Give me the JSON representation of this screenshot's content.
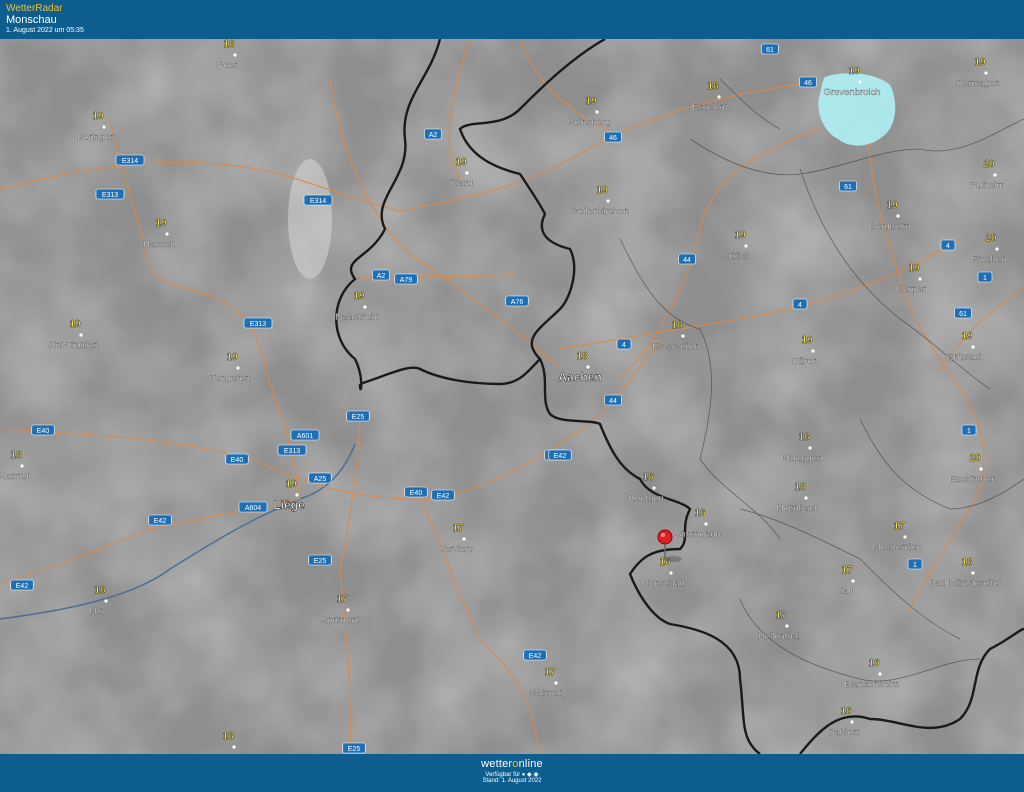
{
  "header": {
    "app_title": "WetterRadar",
    "location": "Monschau",
    "timestamp": "1. August 2022 um 05:35"
  },
  "footer": {
    "brand_a": "wetter",
    "brand_o": "o",
    "brand_b": "nline",
    "available": "Verfügbar für ● ◆ ◉",
    "stand": "Stand: 1. August 2022"
  },
  "colors": {
    "header_bg": "#0d5d8f",
    "accent": "#f2c230",
    "road": "#d98a4a",
    "border": "#1a1a1a",
    "river": "#4a6f96",
    "precip": "#aef1f5",
    "pin": "#e02020"
  },
  "pin": {
    "icon": "location-pin-icon",
    "city": "Monschau"
  },
  "cities": [
    {
      "name": "Peer",
      "temp": "18"
    },
    {
      "name": "Beringen",
      "temp": "19"
    },
    {
      "name": "Heinsberg",
      "temp": "19"
    },
    {
      "name": "Erkelenz",
      "temp": "18"
    },
    {
      "name": "Grevenbroich",
      "temp": "19"
    },
    {
      "name": "Dormagen",
      "temp": "19"
    },
    {
      "name": "Sittard",
      "temp": "19"
    },
    {
      "name": "Geilenkirchen",
      "temp": "19"
    },
    {
      "name": "Pulheim",
      "temp": "20"
    },
    {
      "name": "Hasselt",
      "temp": "19"
    },
    {
      "name": "Bergheim",
      "temp": "19"
    },
    {
      "name": "Jülich",
      "temp": "19"
    },
    {
      "name": "Frechen",
      "temp": "20"
    },
    {
      "name": "Kerpen",
      "temp": "19"
    },
    {
      "name": "Maastricht",
      "temp": "19"
    },
    {
      "name": "Sint-Truiden",
      "temp": "19"
    },
    {
      "name": "Eschweiler",
      "temp": "18"
    },
    {
      "name": "Düren",
      "temp": "19"
    },
    {
      "name": "Erftstadt",
      "temp": "19"
    },
    {
      "name": "Tongeren",
      "temp": "19"
    },
    {
      "name": "Aachen",
      "temp": "18"
    },
    {
      "name": "Nideggen",
      "temp": "18"
    },
    {
      "name": "Hannut",
      "temp": "18"
    },
    {
      "name": "Euskirchen",
      "temp": "20"
    },
    {
      "name": "Liège",
      "temp": "19"
    },
    {
      "name": "Roetgen",
      "temp": "16"
    },
    {
      "name": "Heimbach",
      "temp": "18"
    },
    {
      "name": "Simmerath",
      "temp": "16"
    },
    {
      "name": "Verviers",
      "temp": "17"
    },
    {
      "name": "Mechernich",
      "temp": "17"
    },
    {
      "name": "Monschau",
      "temp": "16"
    },
    {
      "name": "Kall",
      "temp": "17"
    },
    {
      "name": "Bad Münstereifel",
      "temp": "18"
    },
    {
      "name": "Huy",
      "temp": "18"
    },
    {
      "name": "Sprimont",
      "temp": "17"
    },
    {
      "name": "Hellenthal",
      "temp": "17"
    },
    {
      "name": "Blankenheim",
      "temp": "16"
    },
    {
      "name": "Malmedy",
      "temp": "17"
    },
    {
      "name": "Dahlem",
      "temp": "16"
    },
    {
      "name": "Durbuy",
      "temp": "18"
    }
  ],
  "road_shields": [
    "61",
    "46",
    "46",
    "A2",
    "E314",
    "E313",
    "E314",
    "61",
    "4",
    "44",
    "A2",
    "A79",
    "A76",
    "4",
    "4",
    "1",
    "61",
    "E313",
    "E25",
    "A601",
    "E40",
    "E313",
    "E40",
    "E40",
    "A25",
    "E40",
    "E42",
    "E42",
    "A604",
    "E42",
    "1",
    "1",
    "E25",
    "E42",
    "E25",
    "44",
    "E42"
  ]
}
